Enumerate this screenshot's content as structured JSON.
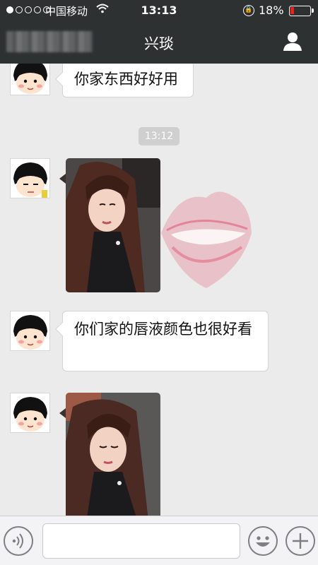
{
  "status_bar": {
    "carrier": "中国移动",
    "time": "13:13",
    "battery_percent": "18%",
    "battery_level": 0.18,
    "signal_dots_filled": 1,
    "signal_dots_total": 5,
    "icons": [
      "wifi-icon",
      "rotation-lock-icon",
      "battery-icon"
    ]
  },
  "nav_bar": {
    "title": "兴琰",
    "right_icon": "user-profile-icon"
  },
  "chat": {
    "messages": [
      {
        "type": "text",
        "text": "你家东西好好用"
      },
      {
        "type": "timestamp",
        "text": "13:12"
      },
      {
        "type": "image",
        "description_icon": "photo"
      },
      {
        "type": "text",
        "text": "你们家的唇液颜色也很好看"
      },
      {
        "type": "image",
        "description_icon": "photo"
      }
    ]
  },
  "input_bar": {
    "voice_icon": "voice-icon",
    "emoji_icon": "emoji-icon",
    "more_icon": "plus-icon"
  },
  "colors": {
    "bar_background": "#2e3132",
    "chat_background": "#ebebeb",
    "battery_low": "#e6231c"
  }
}
